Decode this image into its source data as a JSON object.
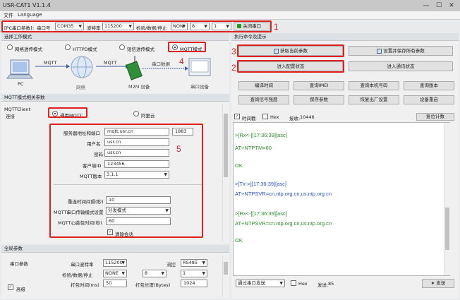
{
  "app": {
    "title": "USR-CAT1 V1.1.4",
    "minimize": "—",
    "maximize": "☐",
    "close": "✕"
  },
  "menu": {
    "file": "文件",
    "language": "Language"
  },
  "config_bar": {
    "pc_port_label": "[PC串口参数]：串口号",
    "port": "COM35",
    "baud_label": "波特率",
    "baud": "115200",
    "parity_label": "检验/数据/停止",
    "parity": "NONI",
    "data_bits": "8",
    "stop_bits": "1",
    "close_port": "关闭串口",
    "close_icon_color": "#1ea01e"
  },
  "annotations": {
    "n1": "1",
    "n2": "2",
    "n3": "3",
    "n4": "4",
    "n5": "5",
    "color": "#e02020"
  },
  "work_mode": {
    "header": "选择工作模式",
    "modes": [
      "网络透传模式",
      "HTTPD模式",
      "短信透传模式",
      "MQTT模式"
    ],
    "selected": "MQTT模式",
    "diagram": {
      "pc": "PC",
      "mqtt1": "MQTT",
      "mqtt2": "MQTT",
      "cloud": "网络",
      "device": "M2M 设备",
      "serial_data": "串口数据",
      "serial_device": "串口设备"
    }
  },
  "mqtt": {
    "header": "MQTT模式相关参数",
    "side_title": "MQTTClient",
    "side_sub": "连接",
    "server_options": [
      "通用MQTT",
      "阿里云"
    ],
    "selected_server": "通用MQTT",
    "fields": {
      "server_label": "服务器地址和端口",
      "server": "mqtt.usr.cn",
      "port": "1883",
      "username_label": "用户名",
      "username": "usr.cn",
      "password_label": "密码",
      "password": "usr.cn",
      "client_id_label": "客户端ID",
      "client_id": "123456",
      "version_label": "MQTT版本",
      "version": "3.1.1",
      "reconnect_label": "重连时间间隔(秒)",
      "reconnect": "10",
      "transfer_label": "MQTT串口传输模式设置",
      "transfer": "分发模式",
      "heartbeat_label": "MQTT心跳包时间(秒)",
      "heartbeat": "60",
      "clean_session": "清除会话",
      "clean_session_checked": true
    }
  },
  "global": {
    "header": "全局参数",
    "serial_params": "串口参数",
    "baud_label": "串口波特率",
    "baud": "115200",
    "flow_label": "流控",
    "flow": "RS485",
    "parity_label": "检验/数据/停止",
    "parity": "NONE",
    "data_bits": "8",
    "stop_bits": "1",
    "pack_time_label": "打包时间(ms)",
    "pack_time": "50",
    "pack_len_label": "打包长度(Bytes)",
    "pack_len": "1024",
    "advanced": "高级",
    "advanced_checked": true
  },
  "commands": {
    "header": "执行命令及提示",
    "get_params": "获取当前参数",
    "save_all": "设置并保存所有参数",
    "enter_config": "进入配置状态",
    "enter_comm": "进入通讯状态",
    "grid": [
      "编译时间",
      "查询IMEI",
      "查询本机号码",
      "查询版本",
      "查询信号强度",
      "保存参数",
      "恢复出厂设置",
      "设备重启"
    ]
  },
  "log_opts": {
    "timestamp": "时间戳",
    "timestamp_checked": true,
    "hex": "Hex",
    "hex_checked": false,
    "received_label": "接收:",
    "received": "10446",
    "reset_count": "复位计数"
  },
  "terminal": [
    {
      "kind": "rx",
      "text": ">[Rx<-][17:36:39][asc]"
    },
    {
      "kind": "rx",
      "text": "AT+NTPTM=60"
    },
    {
      "kind": "rx",
      "text": "OK"
    },
    {
      "kind": "tx",
      "text": ">[Tx->][17:36:39][asc]"
    },
    {
      "kind": "tx",
      "text": "AT+NTPSVR=cn.ntp.org.cn,us.ntp.org.cn"
    },
    {
      "kind": "rx",
      "text": ">[Rx<-][17:36:39][asc]"
    },
    {
      "kind": "rx",
      "text": "AT+NTPSVR=cn.ntp.org.cn,us.ntp.org.cn"
    },
    {
      "kind": "rx",
      "text": "OK"
    }
  ],
  "send_bar": {
    "mode": "通过串口发送",
    "hex": "Hex",
    "sent_label": "发送:",
    "sent": "85",
    "send_button": "发送"
  }
}
